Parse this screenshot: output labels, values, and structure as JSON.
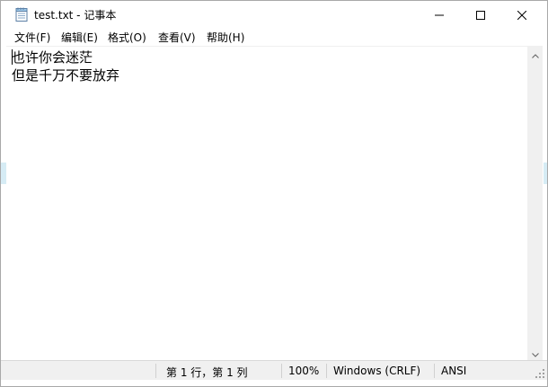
{
  "window": {
    "title": "test.txt - 记事本"
  },
  "menu": {
    "items": [
      {
        "label": "文件(F)"
      },
      {
        "label": "编辑(E)"
      },
      {
        "label": "格式(O)"
      },
      {
        "label": "查看(V)"
      },
      {
        "label": "帮助(H)"
      }
    ]
  },
  "editor": {
    "lines": [
      "也许你会迷茫",
      "但是千万不要放弃"
    ]
  },
  "status": {
    "position": "第 1 行，第 1 列",
    "zoom": "100%",
    "line_ending": "Windows (CRLF)",
    "encoding": "ANSI"
  },
  "icons": {
    "app": "notepad-icon",
    "minimize": "minimize-icon",
    "maximize": "maximize-icon",
    "close": "close-icon"
  },
  "colors": {
    "chrome_background": "#ffffff",
    "statusbar_background": "#f0f0f0",
    "scrollbar_background": "#f0f0f0",
    "text": "#000000"
  }
}
